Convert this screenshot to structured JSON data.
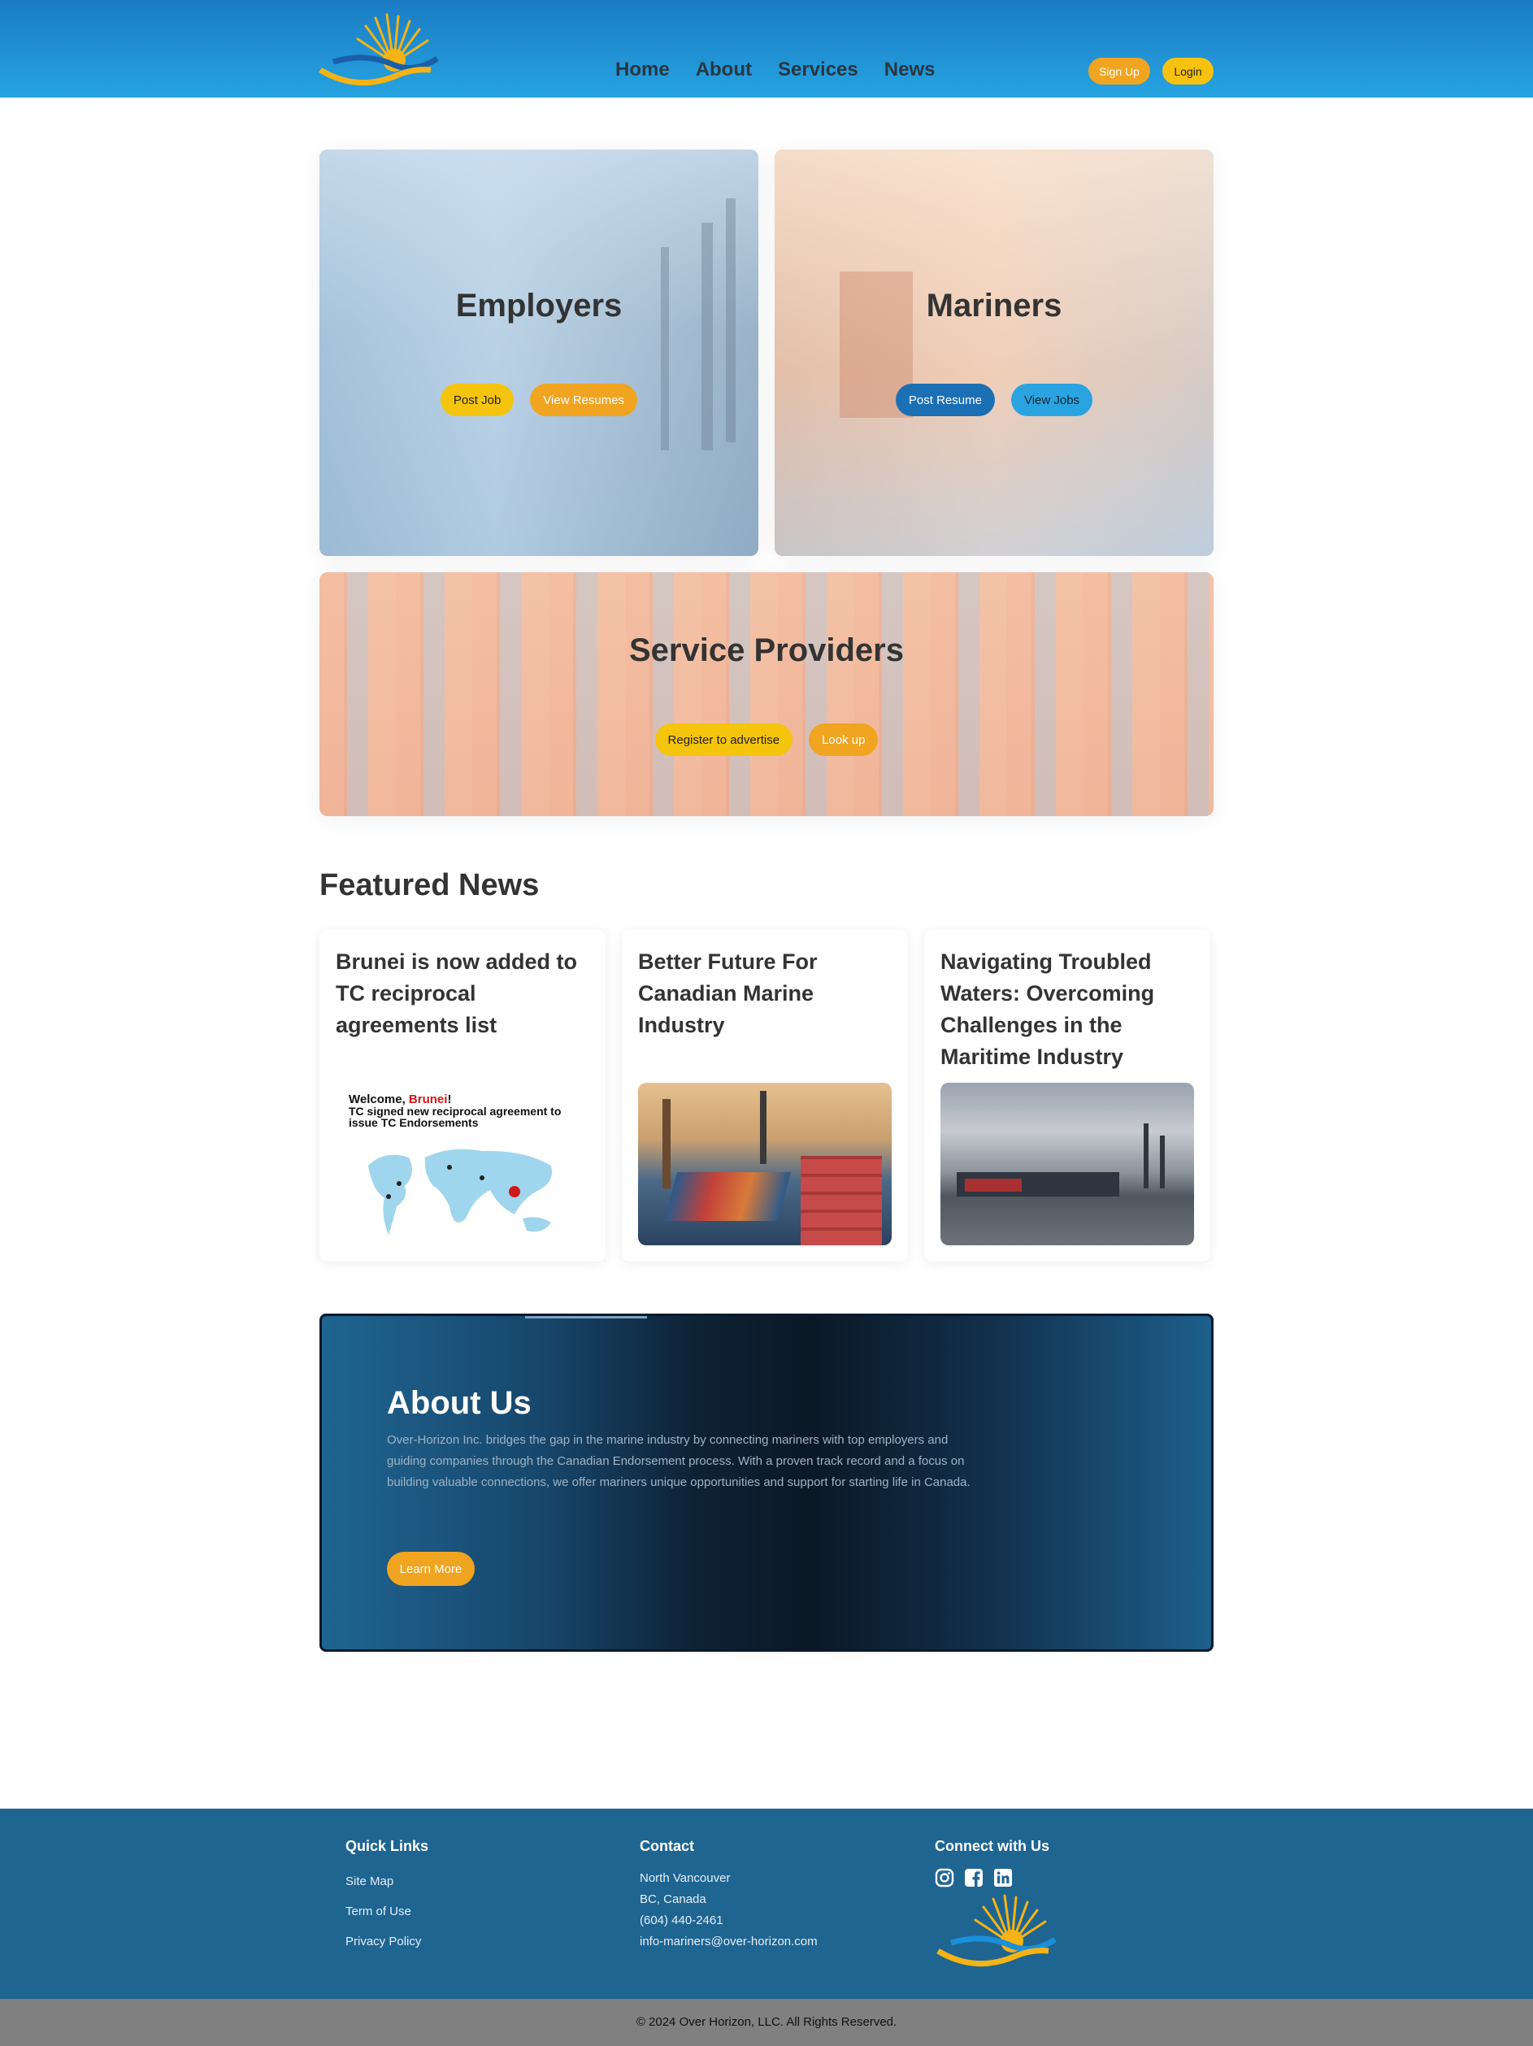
{
  "header": {
    "nav": [
      "Home",
      "About",
      "Services",
      "News"
    ],
    "signup_label": "Sign Up",
    "login_label": "Login"
  },
  "cards": {
    "employers": {
      "title": "Employers",
      "btn1": "Post Job",
      "btn2": "View Resumes"
    },
    "mariners": {
      "title": "Mariners",
      "btn1": "Post Resume",
      "btn2": "View Jobs"
    },
    "service": {
      "title": "Service Providers",
      "btn1": "Register to advertise",
      "btn2": "Look up"
    }
  },
  "news": {
    "heading": "Featured News",
    "items": [
      {
        "title": "Brunei is now added to TC reciprocal agreements list",
        "image_text_1": "Welcome, ",
        "image_text_brunei": "Brunei",
        "image_text_excl": "!",
        "image_text_2": "TC signed new reciprocal agreement to issue TC Endorsements"
      },
      {
        "title": "Better Future For Canadian Marine Industry"
      },
      {
        "title": "Navigating Troubled Waters: Overcoming Challenges in the Maritime Industry"
      }
    ]
  },
  "about": {
    "title": "About Us",
    "body": "Over-Horizon Inc. bridges the gap in the marine industry by connecting mariners with top employers and guiding companies through the Canadian Endorsement process. With a proven track record and a focus on building valuable connections, we offer mariners unique opportunities and support for starting life in Canada.",
    "button": "Learn More"
  },
  "footer": {
    "quick_links_title": "Quick Links",
    "quick_links": [
      "Site Map",
      "Term of Use",
      "Privacy Policy"
    ],
    "contact_title": "Contact",
    "contact": [
      "North Vancouver",
      "BC, Canada",
      "(604) 440-2461",
      "info-mariners@over-horizon.com"
    ],
    "connect_title": "Connect with Us",
    "social_icons": [
      "instagram-icon",
      "facebook-icon",
      "linkedin-icon"
    ],
    "copyright": "© 2024 Over Horizon, LLC. All Rights Reserved."
  },
  "colors": {
    "brand_blue": "#1f6592",
    "header_blue": "#25a3e0",
    "accent_orange": "#f0a420",
    "accent_yellow": "#f5c40c"
  }
}
